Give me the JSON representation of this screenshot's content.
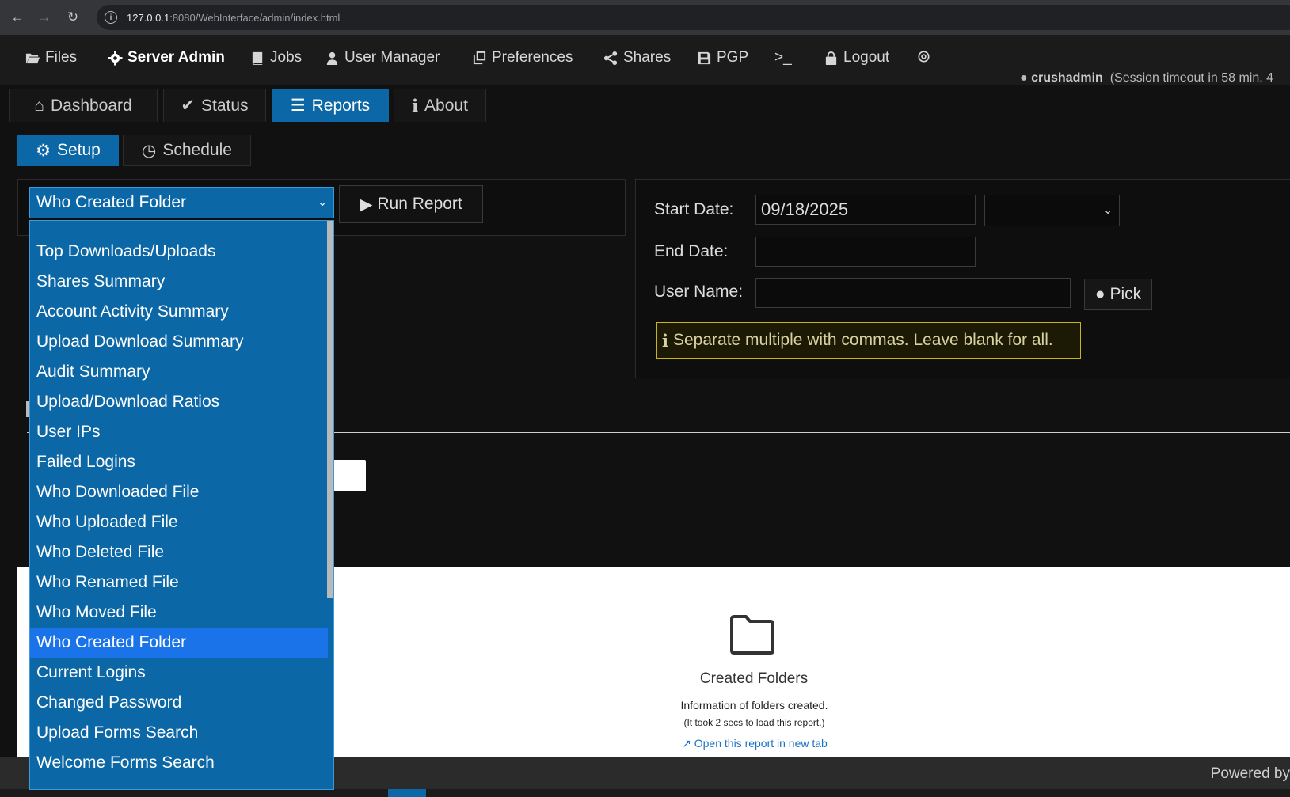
{
  "browser": {
    "url_host": "127.0.0.1",
    "url_rest": ":8080/WebInterface/admin/index.html"
  },
  "topnav": {
    "items": [
      {
        "label": "Files",
        "icon": "folder-open-icon"
      },
      {
        "label": "Server Admin",
        "icon": "gear-icon",
        "active": true
      },
      {
        "label": "Jobs",
        "icon": "book-icon"
      },
      {
        "label": "User Manager",
        "icon": "user-icon"
      },
      {
        "label": "Preferences",
        "icon": "clone-icon"
      },
      {
        "label": "Shares",
        "icon": "share-icon"
      },
      {
        "label": "PGP",
        "icon": "save-icon"
      },
      {
        "label": ">_",
        "icon": "terminal-icon"
      },
      {
        "label": "Logout",
        "icon": "lock-icon"
      },
      {
        "label": "",
        "icon": "settings-cog-icon"
      }
    ],
    "username": "crushadmin",
    "session_text": "(Session timeout in 58 min, 4"
  },
  "tabs_main": [
    {
      "label": "Dashboard",
      "icon": "home-icon"
    },
    {
      "label": "Status",
      "icon": "check-icon"
    },
    {
      "label": "Reports",
      "icon": "list-icon",
      "active": true
    },
    {
      "label": "About",
      "icon": "info-icon"
    }
  ],
  "tabs_sub": [
    {
      "label": "Setup",
      "icon": "gear-icon",
      "active": true
    },
    {
      "label": "Schedule",
      "icon": "clock-icon"
    }
  ],
  "report_select": {
    "value": "Who Created Folder",
    "options": [
      "Top Downloads/Uploads",
      "Shares Summary",
      "Account Activity Summary",
      "Upload Download Summary",
      "Audit Summary",
      "Upload/Download Ratios",
      "User IPs",
      "Failed Logins",
      "Who Downloaded File",
      "Who Uploaded File",
      "Who Deleted File",
      "Who Renamed File",
      "Who Moved File",
      "Who Created Folder",
      "Current Logins",
      "Changed Password",
      "Upload Forms Search",
      "Welcome Forms Search"
    ],
    "selected_index": 13
  },
  "run_button": "Run Report",
  "filters": {
    "start_label": "Start Date:",
    "start_value": "09/18/2025",
    "end_label": "End Date:",
    "end_value": "",
    "user_label": "User Name:",
    "user_value": "",
    "pick_label": "Pick",
    "hint": "Separate multiple with commas. Leave blank for all."
  },
  "report_card": {
    "title": "Created Folders",
    "description": "Information of folders created.",
    "load_time": "(It took 2 secs to load this report.)",
    "open_link": "Open this report in new tab"
  },
  "footer": {
    "powered": "Powered by"
  },
  "colors": {
    "accent": "#0b67a6",
    "selected_option": "#1a73e8",
    "hint_border": "#c9b51a"
  }
}
